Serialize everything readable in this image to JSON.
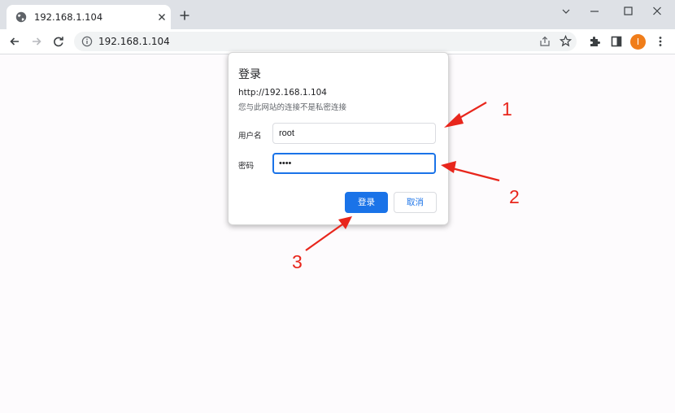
{
  "browser": {
    "tab": {
      "title": "192.168.1.104"
    },
    "address_bar": {
      "url": "192.168.1.104"
    },
    "profile_initial": "I",
    "icons": [
      "globe-icon",
      "close-icon",
      "plus-icon",
      "minimize-icon",
      "maximize-icon",
      "window-close-icon",
      "back-icon",
      "forward-icon",
      "reload-icon",
      "info-icon",
      "share-icon",
      "star-icon",
      "extensions-icon",
      "side-panel-icon",
      "menu-icon"
    ]
  },
  "dialog": {
    "title": "登录",
    "origin": "http://192.168.1.104",
    "warning": "您与此网站的连接不是私密连接",
    "username": {
      "label": "用户名",
      "value": "root"
    },
    "password": {
      "label": "密码",
      "value": "root"
    },
    "buttons": {
      "login": "登录",
      "cancel": "取消"
    }
  },
  "annotations": {
    "color": "#e8261c",
    "labels": [
      "1",
      "2",
      "3"
    ]
  },
  "colors": {
    "accent": "#1a73e8",
    "profile": "#f07d1a",
    "tabstrip": "#dee1e6"
  }
}
